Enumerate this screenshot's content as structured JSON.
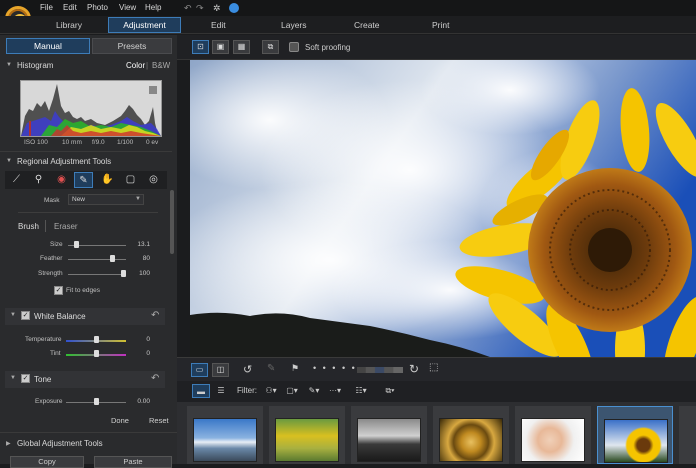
{
  "menubar": {
    "file": "File",
    "edit": "Edit",
    "photo": "Photo",
    "view": "View",
    "help": "Help"
  },
  "modes": {
    "library": "Library",
    "adjustment": "Adjustment",
    "edit": "Edit",
    "layers": "Layers",
    "create": "Create",
    "print": "Print"
  },
  "panel_tabs": {
    "manual": "Manual",
    "presets": "Presets"
  },
  "histogram": {
    "title": "Histogram",
    "color": "Color",
    "sep": "|",
    "bw": "B&W",
    "iso": "ISO 100",
    "focal": "10 mm",
    "aperture": "f/9.0",
    "shutter": "1/100",
    "ev": "0 ev"
  },
  "regional": {
    "title": "Regional Adjustment Tools"
  },
  "mask": {
    "label": "Mask",
    "value": "New"
  },
  "brush": {
    "brush": "Brush",
    "eraser": "Eraser"
  },
  "sliders": {
    "size": {
      "label": "Size",
      "value": "13.1"
    },
    "feather": {
      "label": "Feather",
      "value": "80"
    },
    "strength": {
      "label": "Strength",
      "value": "100"
    }
  },
  "fit_to_edges": "Fit to edges",
  "white_balance": {
    "title": "White Balance",
    "temperature": "Temperature",
    "temperature_value": "0",
    "tint": "Tint",
    "tint_value": "0"
  },
  "tone": {
    "title": "Tone",
    "exposure": "Exposure",
    "exposure_value": "0.00"
  },
  "actions": {
    "done": "Done",
    "reset": "Reset"
  },
  "global": {
    "title": "Global Adjustment Tools"
  },
  "bottom": {
    "copy": "Copy",
    "paste": "Paste"
  },
  "view": {
    "soft_proofing": "Soft proofing"
  },
  "filter": {
    "label": "Filter:"
  },
  "colors": {
    "accent": "#3d7cb8",
    "selected_bg": "#1f3d5c"
  }
}
